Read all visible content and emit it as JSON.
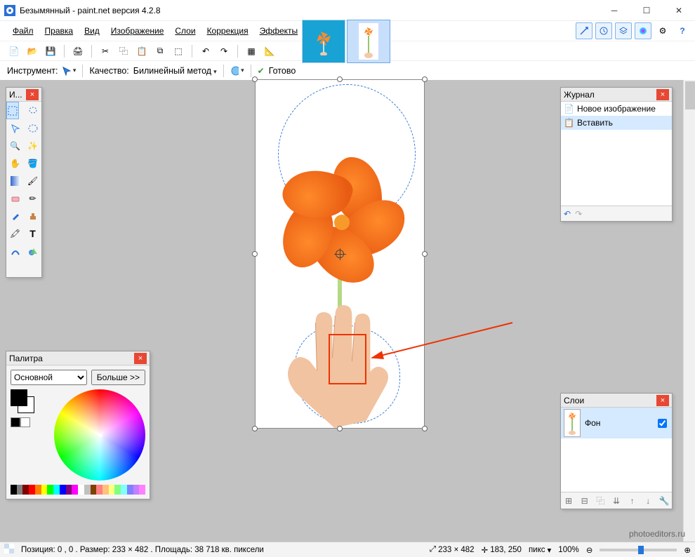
{
  "title": "Безымянный - paint.net версия 4.2.8",
  "menu": [
    "Файл",
    "Правка",
    "Вид",
    "Изображение",
    "Слои",
    "Коррекция",
    "Эффекты"
  ],
  "tool_options": {
    "instrument_label": "Инструмент:",
    "quality_label": "Качество:",
    "quality_value": "Билинейный метод",
    "status": "Готово"
  },
  "panels": {
    "tools_title": "И...",
    "history_title": "Журнал",
    "history_items": [
      "Новое изображение",
      "Вставить"
    ],
    "layers_title": "Слои",
    "layer_name": "Фон",
    "palette_title": "Палитра",
    "palette_mode": "Основной",
    "palette_more": "Больше >>"
  },
  "colors": {
    "primary": "#000000",
    "secondary": "#ffffff",
    "strip": [
      "#000",
      "#7f7f7f",
      "#800000",
      "#f00",
      "#ff8000",
      "#ff0",
      "#0f0",
      "#0ff",
      "#00f",
      "#800080",
      "#f0f",
      "#fff",
      "#c0c0c0",
      "#804000",
      "#ff8080",
      "#ffc080",
      "#ffff80",
      "#80ff80",
      "#80ffff",
      "#8080ff",
      "#c080ff",
      "#ff80ff"
    ]
  },
  "status": {
    "pos_label": "Позиция: 0 , 0 . Размер: 233  × 482 . Площадь: 38 718 кв. пиксели",
    "doc_size": "233 × 482",
    "cursor": "183, 250",
    "units": "пикс",
    "zoom": "100%"
  },
  "watermark": "photoeditors.ru"
}
